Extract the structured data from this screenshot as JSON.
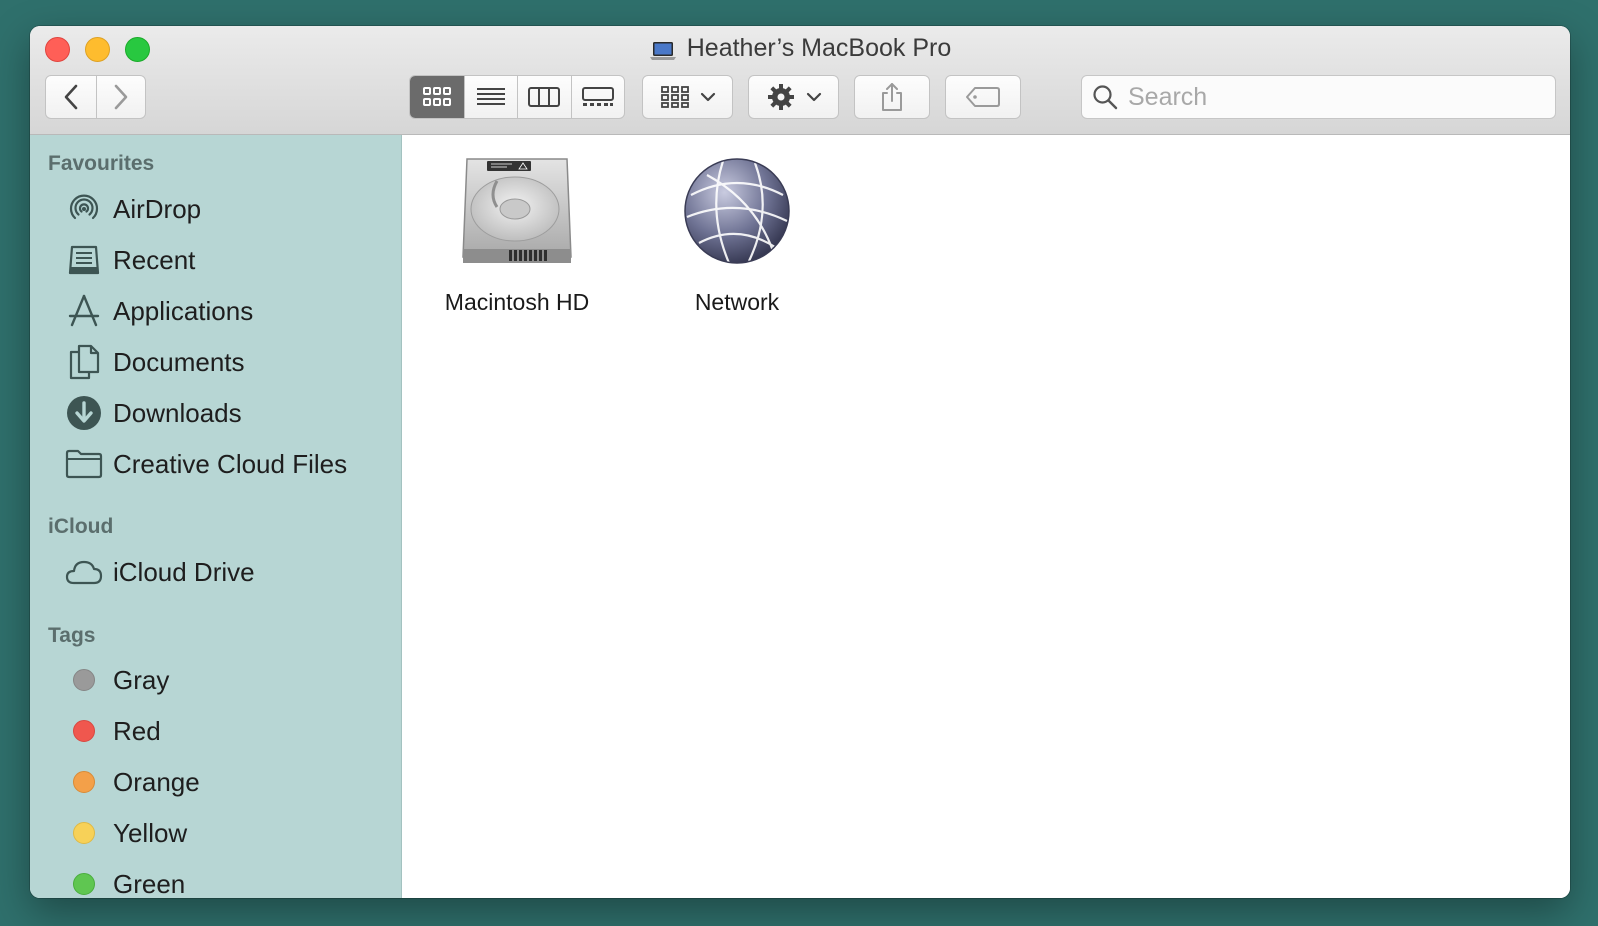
{
  "window": {
    "title": "Heather’s MacBook Pro"
  },
  "toolbar": {
    "back_icon": "chevron-left-icon",
    "forward_icon": "chevron-right-icon",
    "view_modes": [
      "icon-view",
      "list-view",
      "column-view",
      "gallery-view"
    ],
    "active_view": "icon-view",
    "search_placeholder": "Search"
  },
  "sidebar": {
    "favourites_header": "Favourites",
    "favourites": [
      {
        "label": "AirDrop",
        "icon": "airdrop-icon"
      },
      {
        "label": "Recent",
        "icon": "recent-icon"
      },
      {
        "label": "Applications",
        "icon": "applications-icon"
      },
      {
        "label": "Documents",
        "icon": "documents-icon"
      },
      {
        "label": "Downloads",
        "icon": "downloads-icon"
      },
      {
        "label": "Creative Cloud Files",
        "icon": "folder-icon"
      }
    ],
    "icloud_header": "iCloud",
    "icloud": [
      {
        "label": "iCloud Drive",
        "icon": "cloud-icon"
      }
    ],
    "tags_header": "Tags",
    "tags": [
      {
        "label": "Gray",
        "color": "#9a9a9a"
      },
      {
        "label": "Red",
        "color": "#f0574e"
      },
      {
        "label": "Orange",
        "color": "#f3a049"
      },
      {
        "label": "Yellow",
        "color": "#f7d158"
      },
      {
        "label": "Green",
        "color": "#5fc651"
      }
    ]
  },
  "content": {
    "items": [
      {
        "label": "Macintosh HD",
        "icon": "hard-drive-icon"
      },
      {
        "label": "Network",
        "icon": "network-globe-icon"
      }
    ]
  },
  "colors": {
    "desktop": "#2f706c",
    "sidebar": "#b7d6d4",
    "close": "#ff5f57",
    "minimize": "#febc2e",
    "maximize": "#28c840"
  }
}
